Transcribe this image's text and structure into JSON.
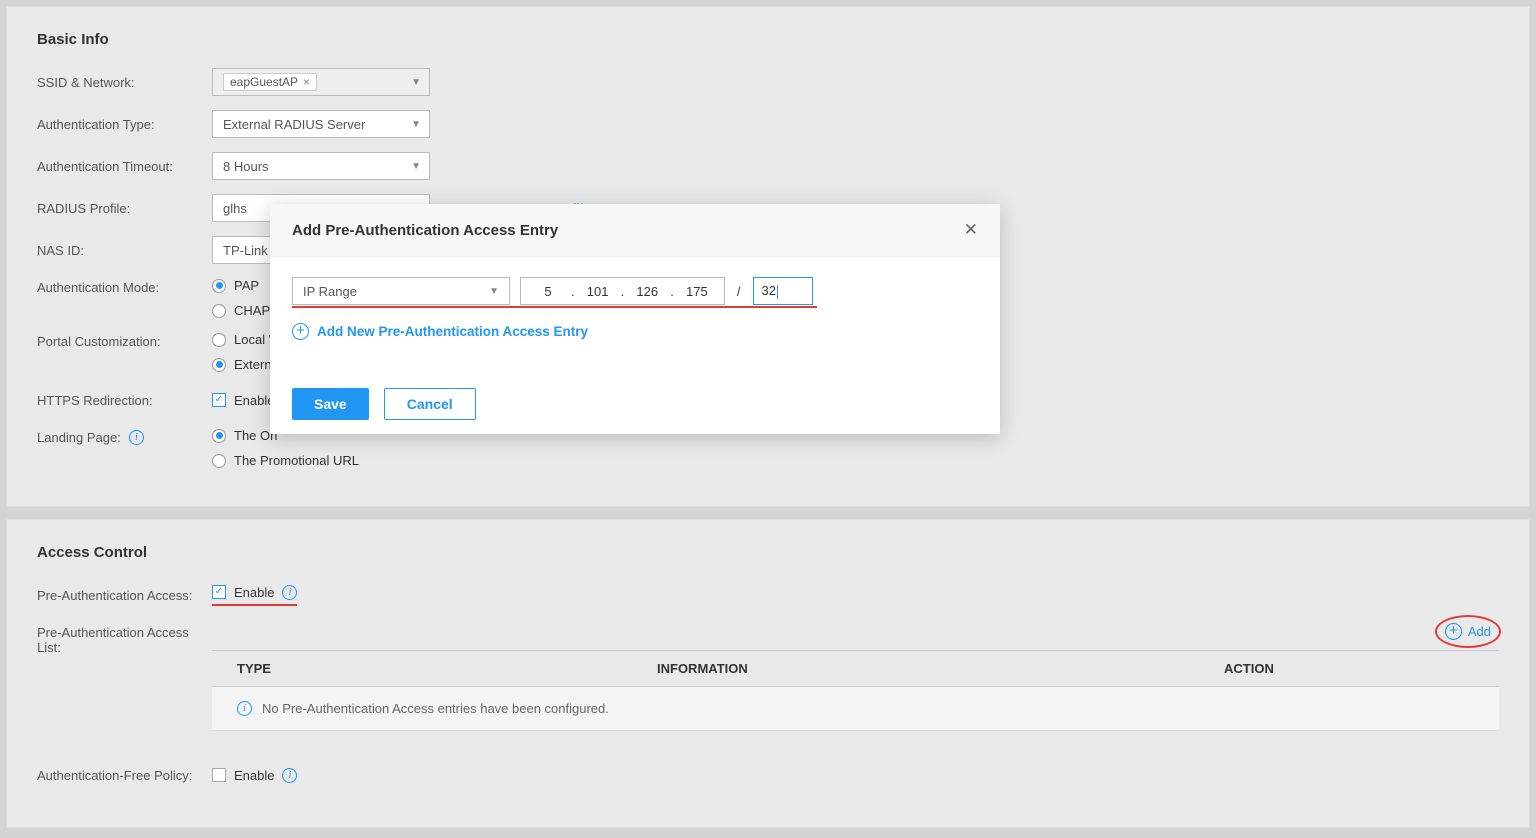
{
  "basicInfo": {
    "title": "Basic Info",
    "fields": {
      "ssid_label": "SSID & Network:",
      "ssid_value": "eapGuestAP",
      "authtype_label": "Authentication Type:",
      "authtype_value": "External RADIUS Server",
      "timeout_label": "Authentication Timeout:",
      "timeout_value": "8 Hours",
      "radius_label": "RADIUS Profile:",
      "radius_value": "glhs",
      "manage_radius": "Manage RADIUS Profile",
      "nasid_label": "NAS ID:",
      "nasid_value": "TP-Link",
      "authmode_label": "Authentication Mode:",
      "authmode_opt1": "PAP",
      "authmode_opt2": "CHAP",
      "portal_label": "Portal Customization:",
      "portal_opt1": "Local W",
      "portal_opt2": "Externa",
      "https_label": "HTTPS Redirection:",
      "https_value": "Enable",
      "landing_label": "Landing Page:",
      "landing_opt1": "The Ori",
      "landing_opt2": "The Promotional URL"
    }
  },
  "accessControl": {
    "title": "Access Control",
    "preauth_label": "Pre-Authentication Access:",
    "preauth_value": "Enable",
    "list_label": "Pre-Authentication Access List:",
    "add_label": "Add",
    "col_type": "TYPE",
    "col_info": "INFORMATION",
    "col_action": "ACTION",
    "empty_msg": "No Pre-Authentication Access entries have been configured.",
    "free_label": "Authentication-Free Policy:",
    "free_value": "Enable"
  },
  "modal": {
    "title": "Add Pre-Authentication Access Entry",
    "type_value": "IP Range",
    "ip": {
      "o1": "5",
      "o2": "101",
      "o3": "126",
      "o4": "175"
    },
    "mask": "32",
    "add_new": "Add New Pre-Authentication Access Entry",
    "save": "Save",
    "cancel": "Cancel"
  }
}
